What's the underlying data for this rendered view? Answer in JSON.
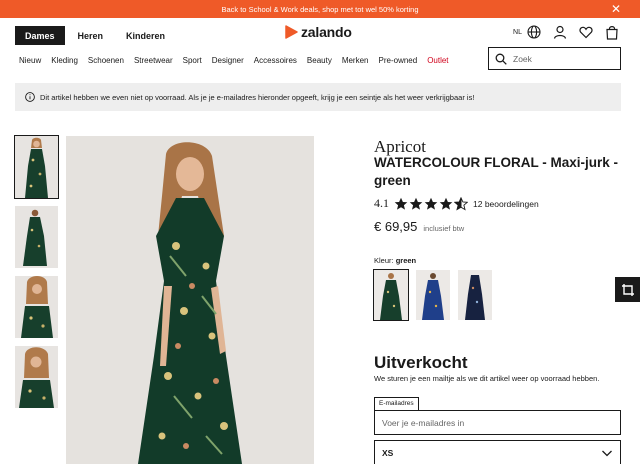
{
  "promo": {
    "text": "Back to School & Work deals, shop met tot wel 50% korting"
  },
  "gender_tabs": [
    {
      "label": "Dames",
      "active": true
    },
    {
      "label": "Heren",
      "active": false
    },
    {
      "label": "Kinderen",
      "active": false
    }
  ],
  "logo": {
    "text": "zalando"
  },
  "header": {
    "language": "NL"
  },
  "categories": [
    "Nieuw",
    "Kleding",
    "Schoenen",
    "Streetwear",
    "Sport",
    "Designer",
    "Accessoires",
    "Beauty",
    "Merken",
    "Pre-owned",
    "Outlet"
  ],
  "search": {
    "placeholder": "Zoek"
  },
  "notice": {
    "text": "Dit artikel hebben we even niet op voorraad. Als je je e-mailadres hieronder opgeeft, krijg je een seintje als het weer verkrijgbaar is!"
  },
  "product": {
    "brand": "Apricot",
    "name": "WATERCOLOUR FLORAL - Maxi-jurk - green",
    "rating": "4.1",
    "reviews": "12 beoordelingen",
    "price": "€ 69,95",
    "vat": "inclusief btw",
    "color_label": "Kleur:",
    "color_value": "green"
  },
  "soldout": {
    "title": "Uitverkocht",
    "subtitle": "We sturen je een mailtje als we dit artikel weer op voorraad hebben."
  },
  "email": {
    "label": "E-mailadres",
    "placeholder": "Voer je e-mailadres in"
  },
  "size": {
    "value": "XS"
  },
  "colors": {
    "accent": "#ef5a28",
    "outlet": "#d0021b",
    "dark": "#1a1a1a"
  }
}
